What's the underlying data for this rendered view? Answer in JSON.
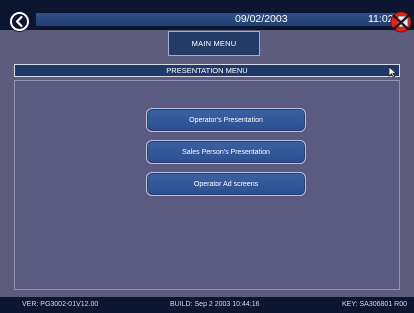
{
  "header": {
    "date": "09/02/2003",
    "time": "11:02"
  },
  "nav": {
    "main_menu_label": "MAIN MENU"
  },
  "page": {
    "title": "PRESENTATION MENU"
  },
  "menu": {
    "items": [
      {
        "label": "Operator's Presentation"
      },
      {
        "label": "Sales Person's Presentation"
      },
      {
        "label": "Operator Ad screens"
      }
    ]
  },
  "status": {
    "version": "VER: PG3002-01V12.00",
    "build": "BUILD:  Sep  2 2003  10:44:16",
    "key": "KEY: SA306801 R00"
  },
  "colors": {
    "background": "#5e5c7c",
    "bar": "#0d1630",
    "accent": "#2b4f8e",
    "close_icon": "#e0211c"
  },
  "icons": {
    "back": "back-arrow-icon",
    "close": "close-x-icon",
    "cursor": "mouse-cursor-icon"
  }
}
